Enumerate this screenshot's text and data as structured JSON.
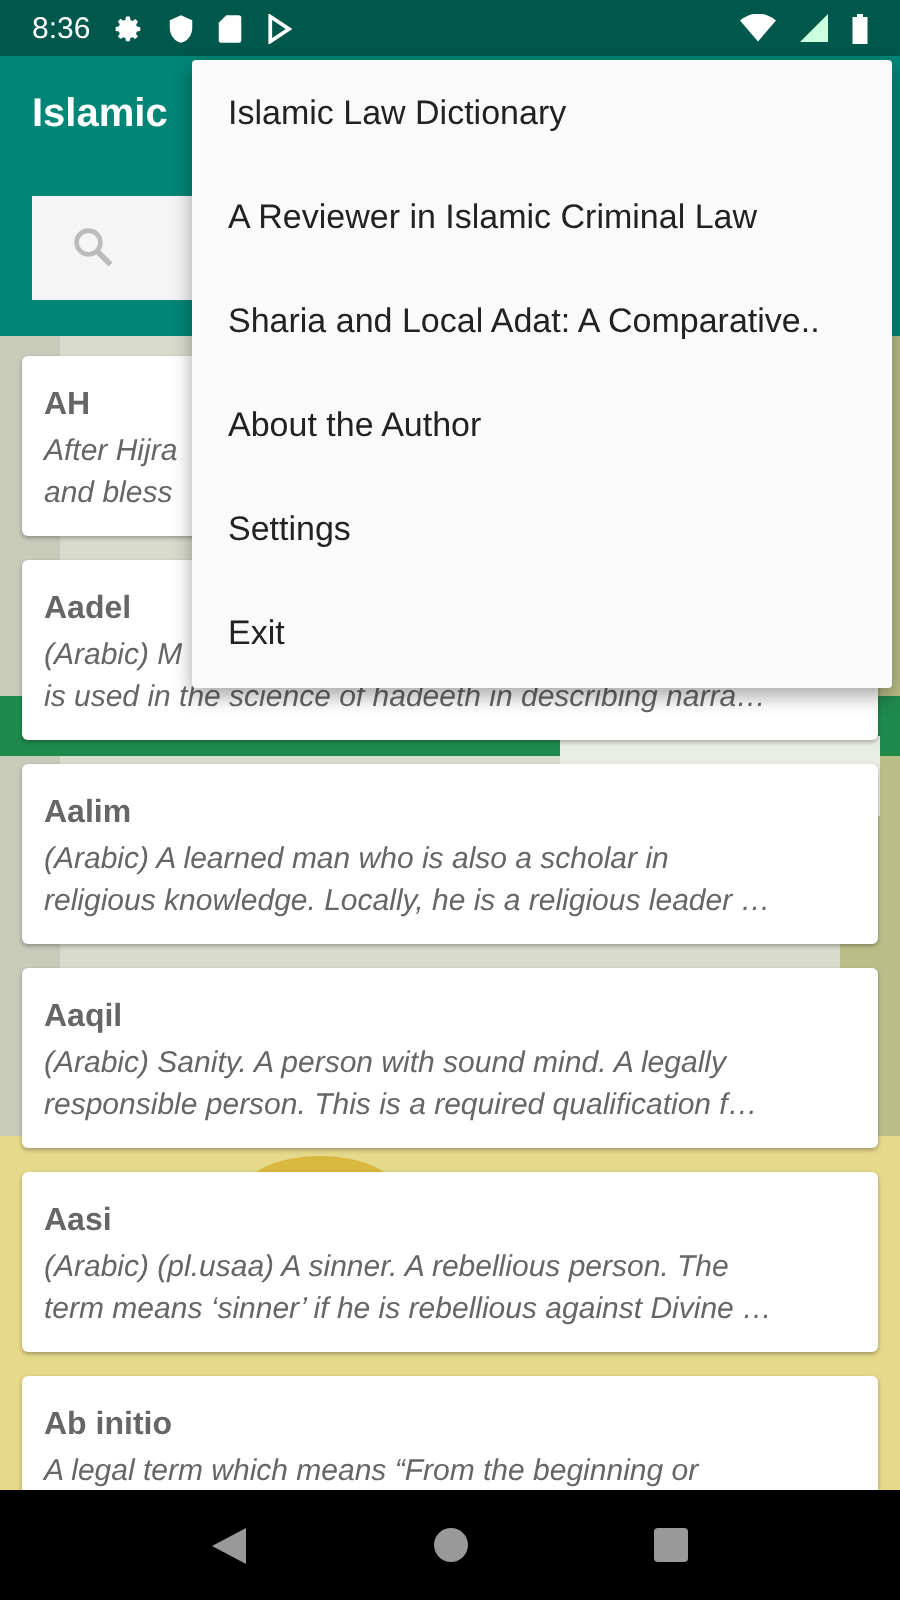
{
  "status_bar": {
    "time": "8:36"
  },
  "app_bar": {
    "title": "Islamic"
  },
  "entries": [
    {
      "term": "AH",
      "lines": [
        "After Hijra",
        "and bless"
      ]
    },
    {
      "term": "Aadel",
      "lines": [
        "(Arabic) M",
        "is used in the science of hadeeth in describing narra…"
      ]
    },
    {
      "term": "Aalim",
      "lines": [
        "(Arabic) A learned man who is also a scholar in",
        "religious knowledge. Locally, he is a religious leader …"
      ]
    },
    {
      "term": "Aaqil",
      "lines": [
        "(Arabic) Sanity. A person with sound mind. A legally",
        "responsible person. This is a required qualification f…"
      ]
    },
    {
      "term": "Aasi",
      "lines": [
        "(Arabic) (pl.usaa) A sinner. A rebellious person. The",
        "term means ‘sinner’ if he is rebellious against Divine …"
      ]
    },
    {
      "term": "Ab initio",
      "lines": [
        "A legal term which means “From the beginning or"
      ]
    }
  ],
  "menu": [
    "Islamic Law Dictionary",
    "A Reviewer in Islamic Criminal Law",
    "Sharia and Local Adat: A Comparative..",
    "About the Author",
    "Settings",
    "Exit"
  ]
}
